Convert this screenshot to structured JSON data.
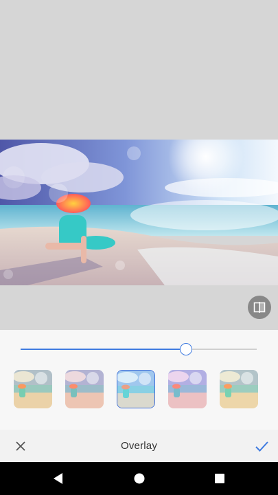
{
  "editor": {
    "tool_title": "Overlay",
    "overlay_intensity": 0.7,
    "selected_filter_index": 2
  },
  "filters": [
    {
      "name": "overlay-1"
    },
    {
      "name": "overlay-2"
    },
    {
      "name": "overlay-3"
    },
    {
      "name": "overlay-4"
    },
    {
      "name": "overlay-5"
    }
  ],
  "icons": {
    "compare": "compare-icon",
    "cancel": "close-icon",
    "apply": "check-icon",
    "back": "nav-back-icon",
    "home": "nav-home-icon",
    "recents": "nav-recents-icon"
  },
  "colors": {
    "accent": "#3f7be0",
    "panel_bg": "#f7f7f7",
    "canvas_bg": "#d6d6d6"
  }
}
